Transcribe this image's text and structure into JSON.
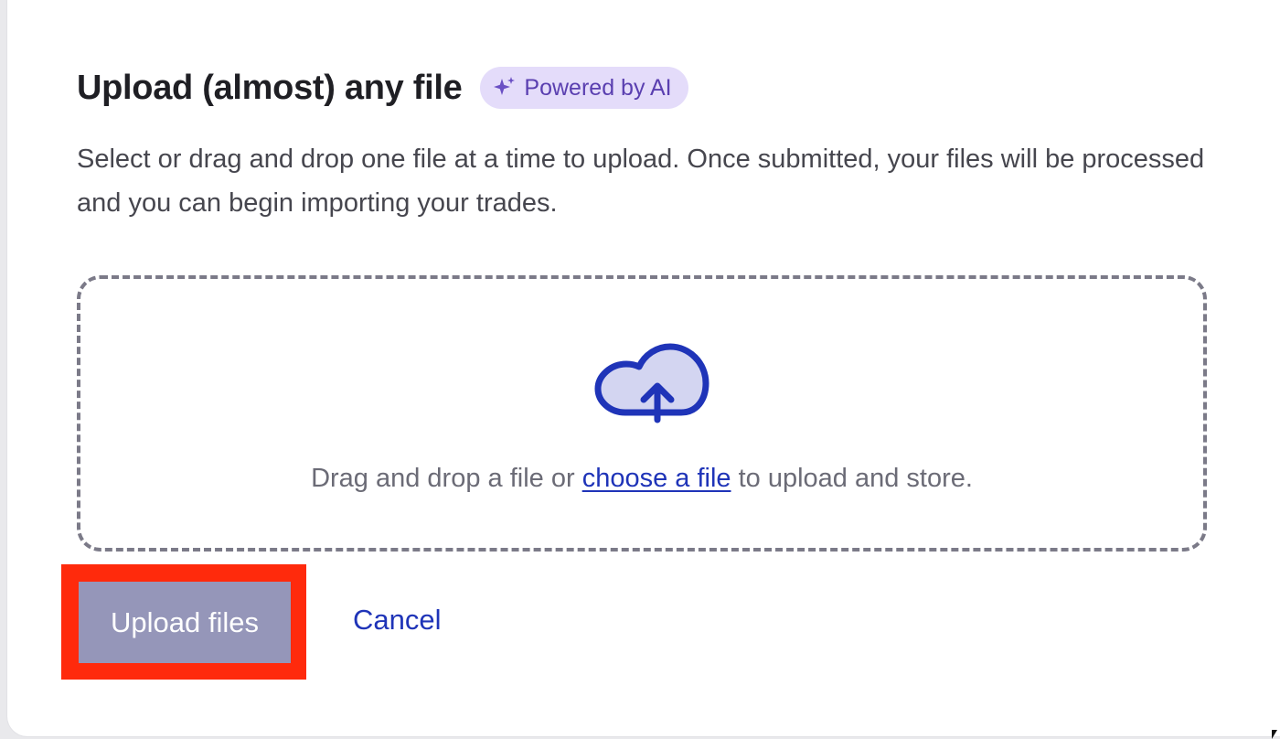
{
  "dialog": {
    "title": "Upload (almost) any file",
    "badge": {
      "label": "Powered by AI",
      "icon": "sparkle-icon",
      "bg_color": "#e4dcfa",
      "text_color": "#5a3fb0"
    },
    "description": "Select or drag and drop one file at a time to upload. Once submitted, your files will be processed and you can begin importing your trades."
  },
  "dropzone": {
    "icon": "cloud-upload-icon",
    "text_before": "Drag and drop a file or ",
    "link_text": "choose a file",
    "text_after": " to upload and store."
  },
  "actions": {
    "upload_label": "Upload files",
    "cancel_label": "Cancel"
  },
  "colors": {
    "accent": "#1f34b8",
    "upload_button_bg": "#9596b9",
    "highlight": "#ff2a0c"
  }
}
